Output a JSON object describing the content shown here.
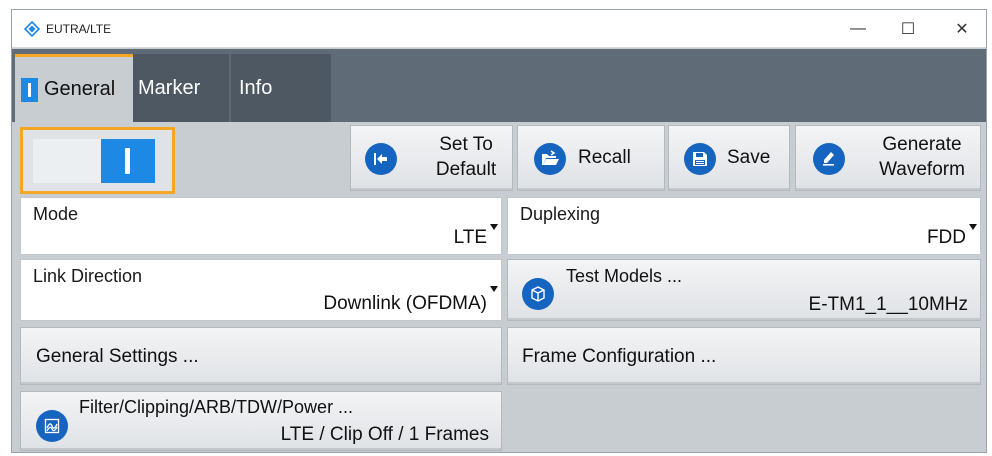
{
  "window": {
    "title": "EUTRA/LTE",
    "minimize_glyph": "—",
    "maximize_glyph": "☐",
    "close_glyph": "✕",
    "app_icon": "rs-diamond-icon"
  },
  "tabs": [
    {
      "label": "General",
      "active": true
    },
    {
      "label": "Marker",
      "active": false
    },
    {
      "label": "Info",
      "active": false
    }
  ],
  "state_toggle": {
    "state": "on"
  },
  "toolbar": {
    "set_to_default_line1": "Set To",
    "set_to_default_line2": "Default",
    "recall": "Recall",
    "save": "Save",
    "generate_line1": "Generate",
    "generate_line2": "Waveform"
  },
  "fields": {
    "mode": {
      "label": "Mode",
      "value": "LTE"
    },
    "duplexing": {
      "label": "Duplexing",
      "value": "FDD"
    },
    "link_direction": {
      "label": "Link Direction",
      "value": "Downlink (OFDMA)"
    },
    "test_models": {
      "label": "Test Models ...",
      "value": "E-TM1_1__10MHz"
    }
  },
  "buttons": {
    "general_settings": "General Settings ...",
    "frame_configuration": "Frame Configuration ...",
    "filter_label": "Filter/Clipping/ARB/TDW/Power ...",
    "filter_value": "LTE / Clip Off / 1 Frames"
  },
  "colors": {
    "accent_orange": "#f5a623",
    "primary_blue": "#1e88e5",
    "icon_blue": "#1565c0",
    "tabbar_gray": "#5f6b76"
  }
}
